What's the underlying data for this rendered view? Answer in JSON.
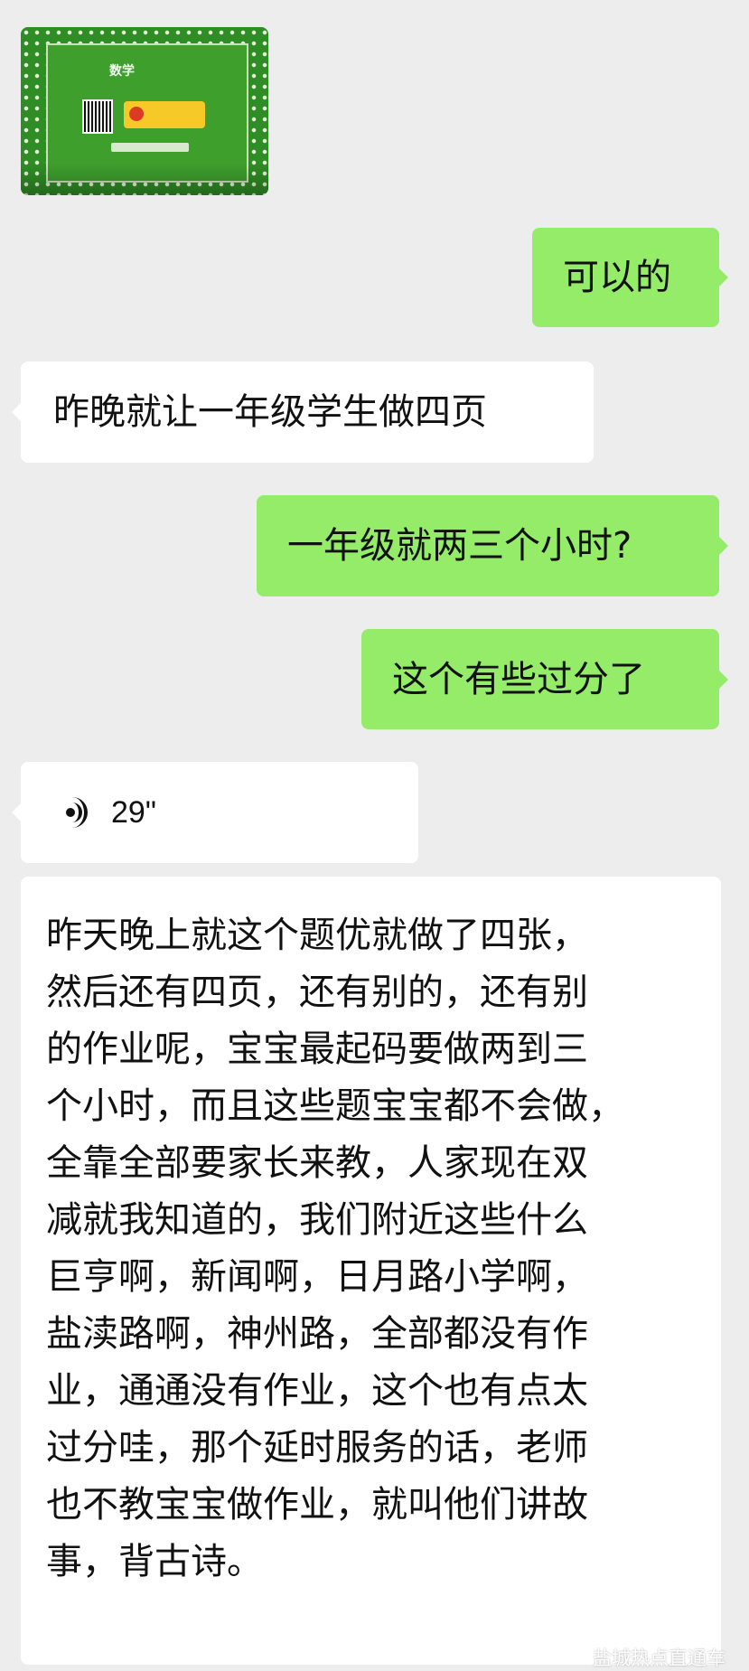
{
  "image_message": {
    "title": "数学"
  },
  "messages": [
    {
      "side": "right",
      "text": "可以的"
    },
    {
      "side": "left",
      "text": "昨晚就让一年级学生做四页"
    },
    {
      "side": "right",
      "text": "一年级就两三个小时?"
    },
    {
      "side": "right",
      "text": "这个有些过分了"
    }
  ],
  "voice_message": {
    "duration": "29\""
  },
  "long_message": {
    "lines": [
      "昨天晚上就这个题优就做了四张，",
      "然后还有四页，还有别的，还有别",
      "的作业呢，宝宝最起码要做两到三",
      "个小时，而且这些题宝宝都不会做，",
      "全靠全部要家长来教，人家现在双",
      "减就我知道的，我们附近这些什么",
      "巨亨啊，新闻啊，日月路小学啊，",
      "盐渎路啊，神州路，全部都没有作",
      "业，通通没有作业，这个也有点太",
      "过分哇，那个延时服务的话，老师",
      "也不教宝宝做作业，就叫他们讲故",
      "事，背古诗。"
    ]
  },
  "watermark": {
    "text": "盐城热点直通车",
    "icon": "wechat-icon"
  },
  "colors": {
    "background": "#ededed",
    "right_bubble": "#95ec69",
    "left_bubble": "#ffffff"
  }
}
